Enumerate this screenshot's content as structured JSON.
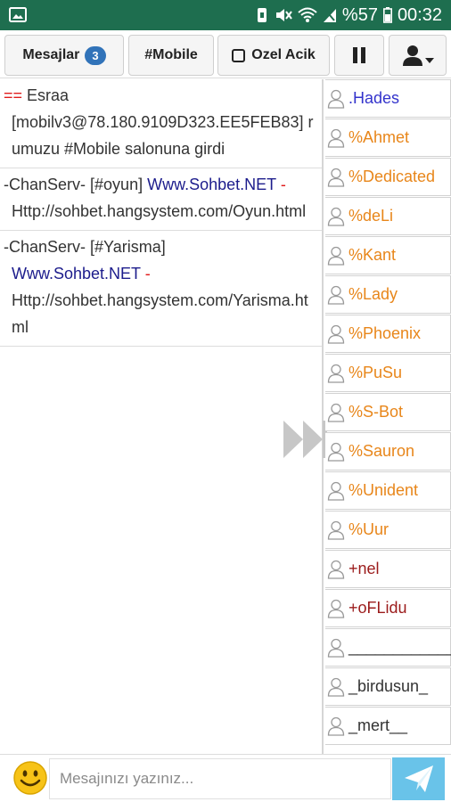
{
  "status_bar": {
    "battery_text": "%57",
    "time": "00:32"
  },
  "toolbar": {
    "messages_label": "Mesajlar",
    "messages_count": "3",
    "channel_label": "#Mobile",
    "private_label": "Ozel Acik"
  },
  "messages": [
    {
      "prefix": "==",
      "line1": " Esraa",
      "line2": "[mobilv3@78.180.9109D323.EE5FEB83] rumuzu #Mobile salonuna girdi"
    },
    {
      "sender": "-ChanServ- [#oyun] ",
      "link": "Www.Sohbet.NET",
      "dash": " -",
      "url": "Http://sohbet.hangsystem.com/Oyun.html"
    },
    {
      "sender": "-ChanServ- [#Yarisma]",
      "link": "Www.Sohbet.NET",
      "dash": " -",
      "url": "Http://sohbet.hangsystem.com/Yarisma.html"
    }
  ],
  "users": [
    {
      "name": ".Hades",
      "color": "#3333cc"
    },
    {
      "name": "%Ahmet",
      "color": "#e8861a"
    },
    {
      "name": "%Dedicated",
      "color": "#e8861a"
    },
    {
      "name": "%deLi",
      "color": "#e8861a"
    },
    {
      "name": "%Kant",
      "color": "#e8861a"
    },
    {
      "name": "%Lady",
      "color": "#e8861a"
    },
    {
      "name": "%Phoenix",
      "color": "#e8861a"
    },
    {
      "name": "%PuSu",
      "color": "#e8861a"
    },
    {
      "name": "%S-Bot",
      "color": "#e8861a"
    },
    {
      "name": "%Sauron",
      "color": "#e8861a"
    },
    {
      "name": "%Unident",
      "color": "#e8861a"
    },
    {
      "name": "%Uur",
      "color": "#e8861a"
    },
    {
      "name": "+nel",
      "color": "#9b1b1b"
    },
    {
      "name": "+oFLidu",
      "color": "#9b1b1b"
    },
    {
      "name": "____________",
      "color": "#333333"
    },
    {
      "name": "_birdusun_",
      "color": "#333333"
    },
    {
      "name": "_mert__",
      "color": "#333333"
    }
  ],
  "input": {
    "placeholder": "Mesajınızı yazınız..."
  }
}
